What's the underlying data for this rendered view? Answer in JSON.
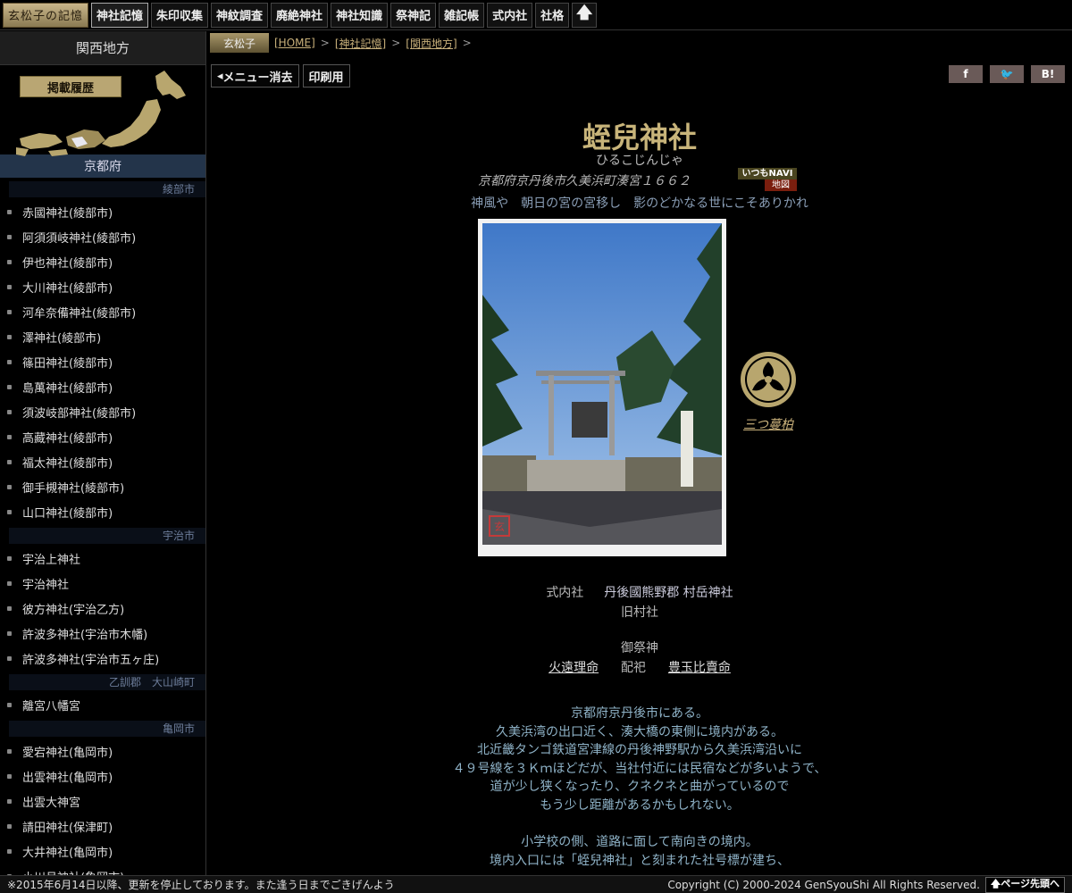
{
  "nav": {
    "logo": "玄松子の記憶",
    "items": [
      "神社記憶",
      "朱印収集",
      "神紋調査",
      "廃絶神社",
      "神社知識",
      "祭神記",
      "雑記帳",
      "式内社",
      "社格"
    ],
    "up_label": "🡅"
  },
  "sidebar": {
    "region": "関西地方",
    "history_label": "掲載履歴",
    "prefecture": "京都府",
    "groups": [
      {
        "category": "綾部市",
        "items": [
          "赤國神社(綾部市)",
          "阿須須岐神社(綾部市)",
          "伊也神社(綾部市)",
          "大川神社(綾部市)",
          "河牟奈備神社(綾部市)",
          "澤神社(綾部市)",
          "篠田神社(綾部市)",
          "島萬神社(綾部市)",
          "須波岐部神社(綾部市)",
          "高藏神社(綾部市)",
          "福太神社(綾部市)",
          "御手槻神社(綾部市)",
          "山口神社(綾部市)"
        ]
      },
      {
        "category": "宇治市",
        "items": [
          "宇治上神社",
          "宇治神社",
          "彼方神社(宇治乙方)",
          "許波多神社(宇治市木幡)",
          "許波多神社(宇治市五ヶ庄)"
        ]
      },
      {
        "category": "乙訓郡　大山崎町",
        "items": [
          "離宮八幡宮"
        ]
      },
      {
        "category": "亀岡市",
        "items": [
          "愛宕神社(亀岡市)",
          "出雲神社(亀岡市)",
          "出雲大神宮",
          "請田神社(保津町)",
          "大井神社(亀岡市)",
          "小川月神社(亀岡市)"
        ]
      }
    ]
  },
  "header": {
    "author": "玄松子",
    "breadcrumbs": [
      "[HOME]",
      "[神社記憶]",
      "[関西地方]"
    ],
    "sep": ">"
  },
  "tools": {
    "menu_toggle": "メニュー消去",
    "print": "印刷用"
  },
  "social": {
    "facebook": "f",
    "twitter": "🐦",
    "hatena": "B!"
  },
  "shrine": {
    "name": "蛭兒神社",
    "reading": "ひるこじんじゃ",
    "address": "京都府京丹後市久美浜町湊宮１６６２",
    "navi_top": "いつもNAVI",
    "navi_bottom": "地図",
    "poem": "神風や　朝日の宮の宮移し　影のどかなる世にこそありかれ",
    "crest": "三つ蔓柏",
    "shikinai_label": "式内社",
    "shikinai_value": "丹後國熊野郡 村岳神社",
    "rank": "旧村社",
    "deity_label": "御祭神",
    "deity_main": "火遠理命",
    "deity_with": "配祀",
    "deity_second": "豊玉比賣命",
    "description": [
      "京都府京丹後市にある。",
      "久美浜湾の出口近く、湊大橋の東側に境内がある。",
      "北近畿タンゴ鉄道宮津線の丹後神野駅から久美浜湾沿いに",
      "４９号線を３Ｋｍほどだが、当社付近には民宿などが多いようで、",
      "道が少し狭くなったり、クネクネと曲がっているので",
      "もう少し距離があるかもしれない。",
      "",
      "小学校の側、道路に面して南向きの境内。",
      "境内入口には「蛭兒神社」と刻まれた社号標が建ち、"
    ]
  },
  "footer": {
    "note": "※2015年6月14日以降、更新を停止しております。また逢う日までごきげんよう",
    "copyright": "Copyright (C) 2000-2024 GenSyouShi All Rights Reserved.",
    "pagetop": "🡅ページ先頭へ"
  }
}
